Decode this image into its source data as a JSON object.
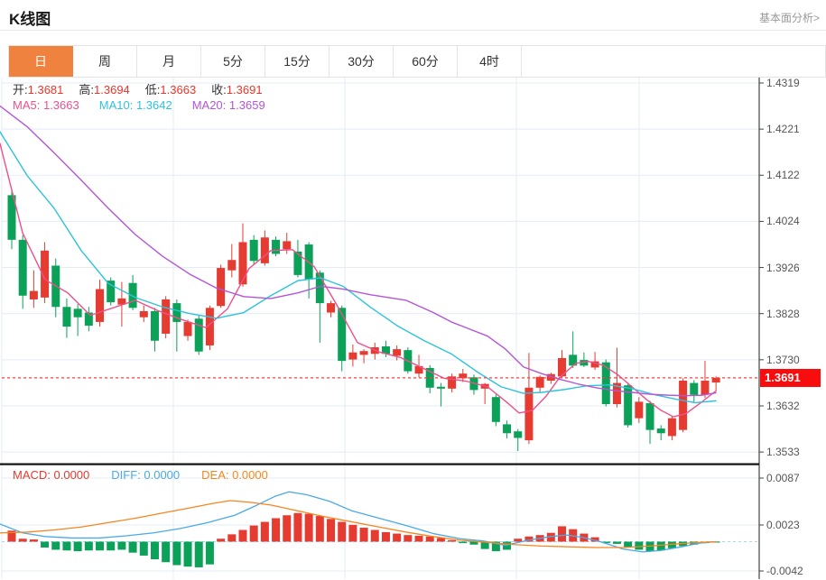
{
  "header": {
    "title": "K线图",
    "link": "基本面分析>"
  },
  "tabs": {
    "items": [
      "日",
      "周",
      "月",
      "5分",
      "15分",
      "30分",
      "60分",
      "4时"
    ],
    "active_index": 0
  },
  "quote": {
    "open_label": "开:",
    "open": "1.3681",
    "high_label": "高:",
    "high": "1.3694",
    "low_label": "低:",
    "low": "1.3663",
    "close_label": "收:",
    "close": "1.3691"
  },
  "ma_row": {
    "ma5_label": "MA5:",
    "ma5": "1.3663",
    "ma10_label": "MA10:",
    "ma10": "1.3642",
    "ma20_label": "MA20:",
    "ma20": "1.3659"
  },
  "macd_row": {
    "macd": "MACD: 0.0000",
    "diff": "DIFF: 0.0000",
    "dea": "DEA: 0.0000"
  },
  "colors": {
    "up": "#e63b30",
    "down": "#0ba158",
    "ma5": "#f0508a",
    "ma10": "#2ec3dc",
    "ma20": "#b455d8",
    "diff": "#4ca9e8",
    "dea": "#f5861f",
    "grid": "#e3ecf7",
    "axis": "#444444",
    "tick_text": "#555555",
    "price_tag_bg": "#f70d0d",
    "dotted_price_line": "#f54040",
    "zero_dashed": "#a6d5f5",
    "tab_active_bg": "#f0823f",
    "separator": "#111111"
  },
  "chart_data": {
    "type": "candlestick_with_macd",
    "title": "K线图 (日K)",
    "price_axis": {
      "min": 1.3533,
      "max": 1.4319,
      "ticks": [
        "1.4319",
        "1.4221",
        "1.4122",
        "1.4024",
        "1.3926",
        "1.3828",
        "1.3730",
        "1.3632",
        "1.3533"
      ],
      "current_price": 1.3691,
      "current_price_label": "1.3691"
    },
    "candles": [
      [
        1.408,
        1.4095,
        1.3965,
        1.3985
      ],
      [
        1.3985,
        1.3995,
        1.3838,
        1.3866
      ],
      [
        1.3858,
        1.392,
        1.384,
        1.3876
      ],
      [
        1.3862,
        1.398,
        1.385,
        1.3962
      ],
      [
        1.393,
        1.3945,
        1.382,
        1.3842
      ],
      [
        1.3842,
        1.386,
        1.3776,
        1.38
      ],
      [
        1.3838,
        1.3848,
        1.378,
        1.382
      ],
      [
        1.383,
        1.3842,
        1.379,
        1.3802
      ],
      [
        1.381,
        1.39,
        1.38,
        1.388
      ],
      [
        1.3898,
        1.3905,
        1.3845,
        1.3852
      ],
      [
        1.3847,
        1.3895,
        1.38,
        1.386
      ],
      [
        1.3893,
        1.391,
        1.3835,
        1.384
      ],
      [
        1.382,
        1.3845,
        1.381,
        1.3833
      ],
      [
        1.3833,
        1.384,
        1.3747,
        1.377
      ],
      [
        1.3785,
        1.3865,
        1.3775,
        1.3858
      ],
      [
        1.385,
        1.3858,
        1.3747,
        1.381
      ],
      [
        1.378,
        1.3815,
        1.377,
        1.381
      ],
      [
        1.3817,
        1.3825,
        1.374,
        1.3747
      ],
      [
        1.376,
        1.3845,
        1.375,
        1.384
      ],
      [
        1.3844,
        1.3932,
        1.384,
        1.3925
      ],
      [
        1.392,
        1.3976,
        1.3905,
        1.3942
      ],
      [
        1.389,
        1.402,
        1.3885,
        1.398
      ],
      [
        1.3985,
        1.3995,
        1.3932,
        1.394
      ],
      [
        1.3935,
        1.4005,
        1.393,
        1.399
      ],
      [
        1.3985,
        1.3992,
        1.395,
        1.3955
      ],
      [
        1.3965,
        1.4,
        1.3955,
        1.3982
      ],
      [
        1.396,
        1.3985,
        1.3905,
        1.391
      ],
      [
        1.3975,
        1.398,
        1.386,
        1.39
      ],
      [
        1.3915,
        1.392,
        1.3766,
        1.385
      ],
      [
        1.383,
        1.3855,
        1.382,
        1.385
      ],
      [
        1.384,
        1.3845,
        1.3705,
        1.3727
      ],
      [
        1.373,
        1.3762,
        1.3715,
        1.3745
      ],
      [
        1.374,
        1.3752,
        1.3722,
        1.3748
      ],
      [
        1.3742,
        1.3766,
        1.373,
        1.3756
      ],
      [
        1.3758,
        1.377,
        1.3735,
        1.3742
      ],
      [
        1.3738,
        1.376,
        1.3728,
        1.3752
      ],
      [
        1.375,
        1.3756,
        1.37,
        1.3705
      ],
      [
        1.37,
        1.374,
        1.3692,
        1.3716
      ],
      [
        1.3712,
        1.3718,
        1.3658,
        1.367
      ],
      [
        1.3672,
        1.368,
        1.363,
        1.3668
      ],
      [
        1.3668,
        1.37,
        1.366,
        1.3694
      ],
      [
        1.369,
        1.371,
        1.3682,
        1.37
      ],
      [
        1.3692,
        1.3698,
        1.3655,
        1.3665
      ],
      [
        1.3668,
        1.368,
        1.3635,
        1.3678
      ],
      [
        1.365,
        1.3656,
        1.3588,
        1.3597
      ],
      [
        1.3592,
        1.36,
        1.3562,
        1.3573
      ],
      [
        1.3577,
        1.3582,
        1.3535,
        1.3563
      ],
      [
        1.3558,
        1.3744,
        1.355,
        1.367
      ],
      [
        1.367,
        1.3696,
        1.366,
        1.3693
      ],
      [
        1.3685,
        1.3702,
        1.3678,
        1.3699
      ],
      [
        1.3694,
        1.375,
        1.369,
        1.3733
      ],
      [
        1.374,
        1.379,
        1.3712,
        1.3717
      ],
      [
        1.3729,
        1.3745,
        1.3714,
        1.3717
      ],
      [
        1.3713,
        1.3746,
        1.3708,
        1.3726
      ],
      [
        1.3724,
        1.373,
        1.363,
        1.3635
      ],
      [
        1.3635,
        1.3755,
        1.3628,
        1.368
      ],
      [
        1.3675,
        1.368,
        1.3585,
        1.359
      ],
      [
        1.3605,
        1.365,
        1.3595,
        1.364
      ],
      [
        1.3637,
        1.3642,
        1.355,
        1.358
      ],
      [
        1.3583,
        1.359,
        1.3558,
        1.3573
      ],
      [
        1.3567,
        1.361,
        1.3558,
        1.3605
      ],
      [
        1.358,
        1.369,
        1.3575,
        1.3685
      ],
      [
        1.368,
        1.3686,
        1.364,
        1.3655
      ],
      [
        1.3655,
        1.3727,
        1.3648,
        1.3685
      ],
      [
        1.3681,
        1.3694,
        1.3663,
        1.3691
      ]
    ],
    "ma5_line": [
      [
        0,
        1.419
      ],
      [
        25,
        1.4
      ],
      [
        50,
        1.39
      ],
      [
        75,
        1.3872
      ],
      [
        100,
        1.3824
      ],
      [
        125,
        1.384
      ],
      [
        150,
        1.3856
      ],
      [
        175,
        1.3834
      ],
      [
        200,
        1.3816
      ],
      [
        228,
        1.3798
      ],
      [
        252,
        1.3838
      ],
      [
        276,
        1.3924
      ],
      [
        300,
        1.3962
      ],
      [
        324,
        1.3964
      ],
      [
        348,
        1.3928
      ],
      [
        372,
        1.385
      ],
      [
        396,
        1.3766
      ],
      [
        420,
        1.3746
      ],
      [
        444,
        1.3734
      ],
      [
        468,
        1.3712
      ],
      [
        492,
        1.369
      ],
      [
        516,
        1.3684
      ],
      [
        540,
        1.3672
      ],
      [
        562,
        1.3638
      ],
      [
        575,
        1.3616
      ],
      [
        590,
        1.3622
      ],
      [
        605,
        1.3652
      ],
      [
        620,
        1.3692
      ],
      [
        638,
        1.3722
      ],
      [
        652,
        1.3726
      ],
      [
        668,
        1.3718
      ],
      [
        684,
        1.3698
      ],
      [
        700,
        1.3672
      ],
      [
        716,
        1.3645
      ],
      [
        732,
        1.3622
      ],
      [
        746,
        1.3608
      ],
      [
        760,
        1.3615
      ],
      [
        775,
        1.3636
      ],
      [
        793,
        1.3663
      ]
    ],
    "ma10_line": [
      [
        0,
        1.4215
      ],
      [
        30,
        1.4122
      ],
      [
        60,
        1.4052
      ],
      [
        90,
        1.3962
      ],
      [
        120,
        1.3892
      ],
      [
        150,
        1.3862
      ],
      [
        180,
        1.3842
      ],
      [
        210,
        1.3828
      ],
      [
        240,
        1.3818
      ],
      [
        270,
        1.383
      ],
      [
        300,
        1.3866
      ],
      [
        330,
        1.3898
      ],
      [
        355,
        1.3904
      ],
      [
        380,
        1.3886
      ],
      [
        410,
        1.3842
      ],
      [
        440,
        1.3802
      ],
      [
        470,
        1.377
      ],
      [
        500,
        1.3742
      ],
      [
        530,
        1.3702
      ],
      [
        555,
        1.3672
      ],
      [
        580,
        1.3658
      ],
      [
        600,
        1.366
      ],
      [
        625,
        1.3666
      ],
      [
        650,
        1.3674
      ],
      [
        675,
        1.3676
      ],
      [
        700,
        1.3668
      ],
      [
        725,
        1.3655
      ],
      [
        750,
        1.3645
      ],
      [
        770,
        1.3638
      ],
      [
        793,
        1.3642
      ]
    ],
    "ma20_line": [
      [
        0,
        1.427
      ],
      [
        30,
        1.4226
      ],
      [
        60,
        1.417
      ],
      [
        90,
        1.4112
      ],
      [
        120,
        1.4052
      ],
      [
        150,
        1.3996
      ],
      [
        180,
        1.395
      ],
      [
        210,
        1.3912
      ],
      [
        240,
        1.3882
      ],
      [
        270,
        1.3864
      ],
      [
        300,
        1.386
      ],
      [
        330,
        1.3872
      ],
      [
        355,
        1.3886
      ],
      [
        380,
        1.388
      ],
      [
        410,
        1.3868
      ],
      [
        450,
        1.3856
      ],
      [
        480,
        1.383
      ],
      [
        500,
        1.381
      ],
      [
        520,
        1.3795
      ],
      [
        540,
        1.378
      ],
      [
        560,
        1.3752
      ],
      [
        580,
        1.3714
      ],
      [
        600,
        1.37
      ],
      [
        620,
        1.3688
      ],
      [
        640,
        1.3678
      ],
      [
        660,
        1.367
      ],
      [
        680,
        1.3664
      ],
      [
        700,
        1.366
      ],
      [
        720,
        1.3656
      ],
      [
        740,
        1.3654
      ],
      [
        760,
        1.3653
      ],
      [
        778,
        1.3654
      ],
      [
        793,
        1.3659
      ]
    ],
    "macd": {
      "axis_ticks": [
        "0.0087",
        "0.0023",
        "-0.0042"
      ],
      "macd_value": "0.0000",
      "diff_value": "0.0000",
      "dea_value": "0.0000",
      "histogram": [
        0.0015,
        0.0004,
        0.0003,
        -0.0008,
        -0.0011,
        -0.0012,
        -0.0013,
        -0.0012,
        -0.0012,
        -0.0012,
        -0.0011,
        -0.0015,
        -0.0019,
        -0.0024,
        -0.0028,
        -0.0032,
        -0.0034,
        -0.0035,
        -0.0031,
        0.0004,
        0.001,
        0.0016,
        0.0022,
        0.0027,
        0.0032,
        0.0036,
        0.0039,
        0.0038,
        0.0035,
        0.0031,
        0.0027,
        0.0023,
        0.0019,
        0.0016,
        0.0013,
        0.0011,
        0.0009,
        0.0008,
        0.0007,
        0.0005,
        0.0002,
        -0.0002,
        -0.0004,
        -0.001,
        -0.0013,
        -0.0011,
        0.0004,
        0.0007,
        0.0009,
        0.0012,
        0.0021,
        0.0017,
        0.0011,
        0.0006,
        -0.0002,
        -0.0003,
        -0.0008,
        -0.0011,
        -0.0013,
        -0.0012,
        -0.0009,
        -0.0006,
        -0.0004,
        -0.0002,
        -0.0001
      ],
      "diff_line": [
        [
          0,
          0.0024
        ],
        [
          25,
          0.0012
        ],
        [
          50,
          0.0007
        ],
        [
          80,
          0.0005
        ],
        [
          110,
          0.0005
        ],
        [
          140,
          0.0008
        ],
        [
          170,
          0.0012
        ],
        [
          200,
          0.0018
        ],
        [
          230,
          0.0026
        ],
        [
          260,
          0.0036
        ],
        [
          285,
          0.005
        ],
        [
          305,
          0.0062
        ],
        [
          320,
          0.0068
        ],
        [
          340,
          0.0064
        ],
        [
          365,
          0.0055
        ],
        [
          390,
          0.0042
        ],
        [
          420,
          0.0032
        ],
        [
          450,
          0.0022
        ],
        [
          480,
          0.0011
        ],
        [
          510,
          0.0004
        ],
        [
          535,
          0.0001
        ],
        [
          560,
          -0.0005
        ],
        [
          585,
          0.0002
        ],
        [
          610,
          0.0007
        ],
        [
          628,
          0.0009
        ],
        [
          645,
          0.0006
        ],
        [
          665,
          0.0
        ],
        [
          690,
          -0.001
        ],
        [
          712,
          -0.0014
        ],
        [
          732,
          -0.0012
        ],
        [
          755,
          -0.0007
        ],
        [
          775,
          -0.0002
        ],
        [
          793,
          0.0
        ]
      ],
      "dea_line": [
        [
          0,
          0.0012
        ],
        [
          30,
          0.0013
        ],
        [
          60,
          0.0016
        ],
        [
          90,
          0.002
        ],
        [
          120,
          0.0026
        ],
        [
          150,
          0.0032
        ],
        [
          180,
          0.0039
        ],
        [
          210,
          0.0046
        ],
        [
          235,
          0.0052
        ],
        [
          255,
          0.0056
        ],
        [
          275,
          0.0054
        ],
        [
          300,
          0.005
        ],
        [
          330,
          0.0042
        ],
        [
          360,
          0.0034
        ],
        [
          390,
          0.0027
        ],
        [
          420,
          0.002
        ],
        [
          450,
          0.0013
        ],
        [
          480,
          0.0007
        ],
        [
          510,
          0.0002
        ],
        [
          540,
          -0.0001
        ],
        [
          570,
          -0.0004
        ],
        [
          600,
          -0.0006
        ],
        [
          630,
          -0.0007
        ],
        [
          660,
          -0.0008
        ],
        [
          690,
          -0.0008
        ],
        [
          720,
          -0.0006
        ],
        [
          750,
          -0.0003
        ],
        [
          775,
          -0.0001
        ],
        [
          793,
          0.0
        ]
      ]
    }
  }
}
